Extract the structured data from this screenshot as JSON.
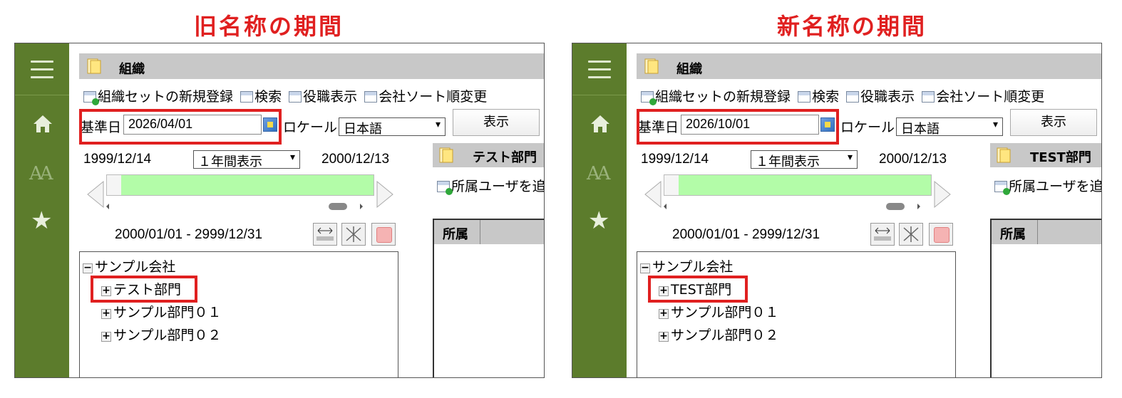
{
  "captions": {
    "left": "旧名称の期間",
    "right": "新名称の期間"
  },
  "panels": [
    {
      "title": "組織",
      "toolbar": {
        "new_set": "組織セットの新規登録",
        "search": "検索",
        "role_display": "役職表示",
        "company_sort": "会社ソート順変更"
      },
      "base_date_label": "基準日",
      "base_date_value": "2026/04/01",
      "locale_label": "ロケール",
      "locale_value": "日本語",
      "display_button": "表示",
      "range_start": "1999/12/14",
      "range_select": "１年間表示",
      "range_end": "2000/12/13",
      "period": "2000/01/01 - 2999/12/31",
      "tree": {
        "root": "サンプル会社",
        "items": [
          "テスト部門",
          "サンプル部門０１",
          "サンプル部門０２"
        ]
      },
      "right": {
        "dept_title": "テスト部門",
        "add_user": "所属ユーザを追",
        "grid_header": "所属"
      }
    },
    {
      "title": "組織",
      "toolbar": {
        "new_set": "組織セットの新規登録",
        "search": "検索",
        "role_display": "役職表示",
        "company_sort": "会社ソート順変更"
      },
      "base_date_label": "基準日",
      "base_date_value": "2026/10/01",
      "locale_label": "ロケール",
      "locale_value": "日本語",
      "display_button": "表示",
      "range_start": "1999/12/14",
      "range_select": "１年間表示",
      "range_end": "2000/12/13",
      "period": "2000/01/01 - 2999/12/31",
      "tree": {
        "root": "サンプル会社",
        "items": [
          "TEST部門",
          "サンプル部門０１",
          "サンプル部門０２"
        ]
      },
      "right": {
        "dept_title": "TEST部門",
        "add_user": "所属ユーザを追",
        "grid_header": "所属"
      }
    }
  ],
  "colors": {
    "sidebar": "#5c7c2c",
    "highlight": "#e02020",
    "slider_fill": "#b3fca8",
    "title_bar": "#c8c8c8"
  }
}
